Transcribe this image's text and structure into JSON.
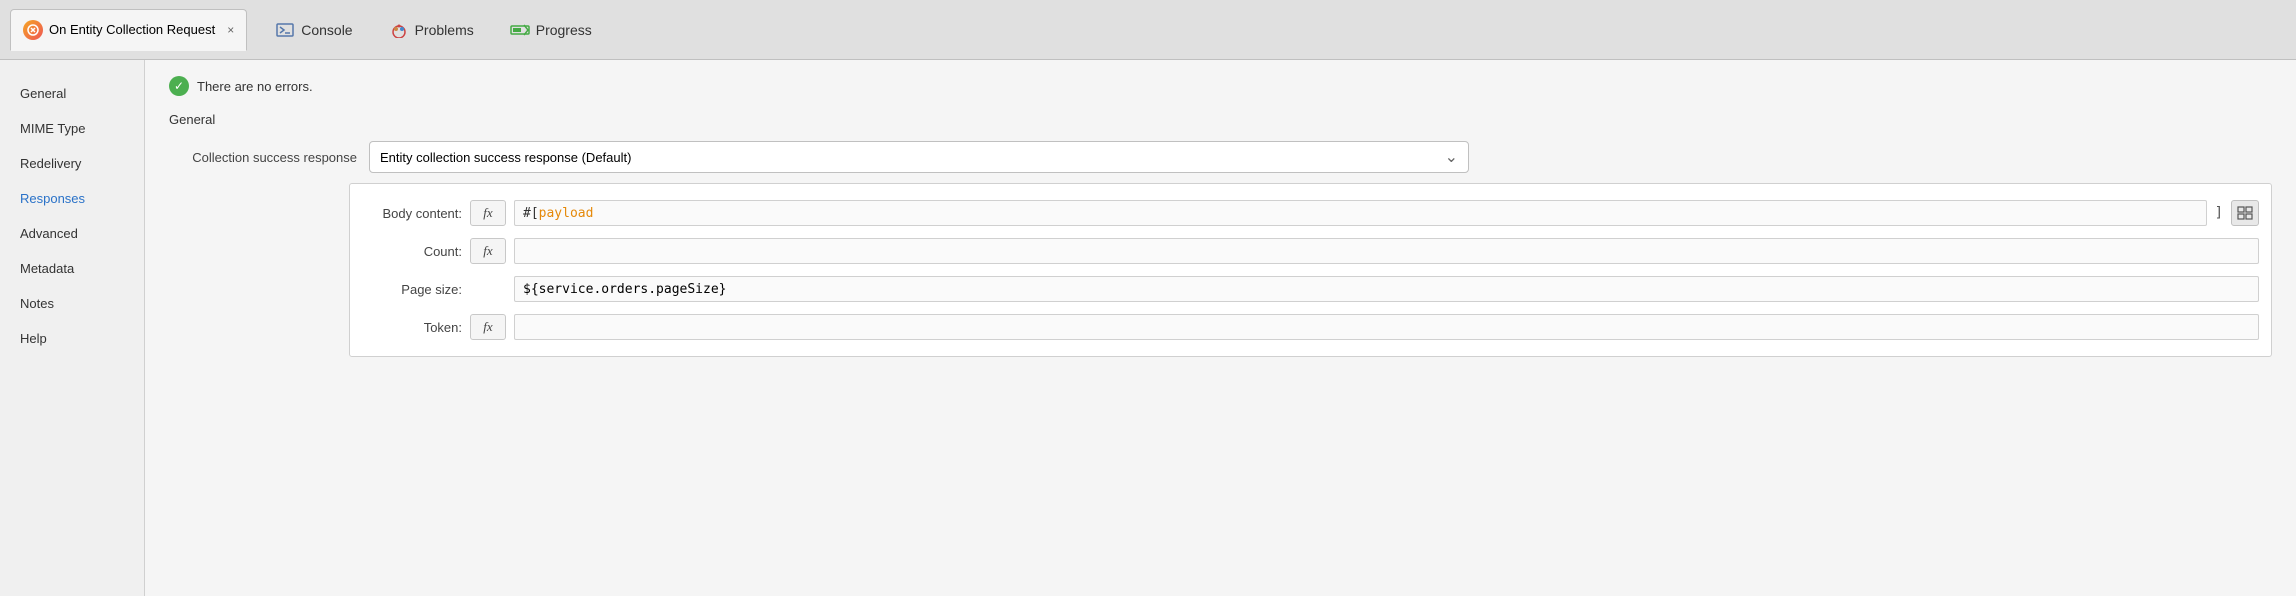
{
  "titlebar": {
    "tab_label": "On Entity Collection Request",
    "tab_close": "×"
  },
  "top_tabs": [
    {
      "id": "console",
      "label": "Console",
      "icon": "console-icon"
    },
    {
      "id": "problems",
      "label": "Problems",
      "icon": "problems-icon"
    },
    {
      "id": "progress",
      "label": "Progress",
      "icon": "progress-icon"
    }
  ],
  "sidebar": {
    "items": [
      {
        "id": "general",
        "label": "General",
        "active": false
      },
      {
        "id": "mime-type",
        "label": "MIME Type",
        "active": false
      },
      {
        "id": "redelivery",
        "label": "Redelivery",
        "active": false
      },
      {
        "id": "responses",
        "label": "Responses",
        "active": true
      },
      {
        "id": "advanced",
        "label": "Advanced",
        "active": false
      },
      {
        "id": "metadata",
        "label": "Metadata",
        "active": false
      },
      {
        "id": "notes",
        "label": "Notes",
        "active": false
      },
      {
        "id": "help",
        "label": "Help",
        "active": false
      }
    ]
  },
  "content": {
    "status_message": "There are no errors.",
    "section_title": "General",
    "collection_success_label": "Collection success response",
    "collection_success_value": "Entity collection success response (Default)",
    "body_content_label": "Body content:",
    "body_content_prefix": "#[ ",
    "body_content_payload": "payload",
    "body_content_suffix": " ]",
    "count_label": "Count:",
    "page_size_label": "Page size:",
    "page_size_value": "${service.orders.pageSize}",
    "token_label": "Token:",
    "fx_label": "fx"
  },
  "colors": {
    "active_tab": "#2a72c8",
    "payload_color": "#e5890a",
    "success_green": "#4CAF50"
  }
}
